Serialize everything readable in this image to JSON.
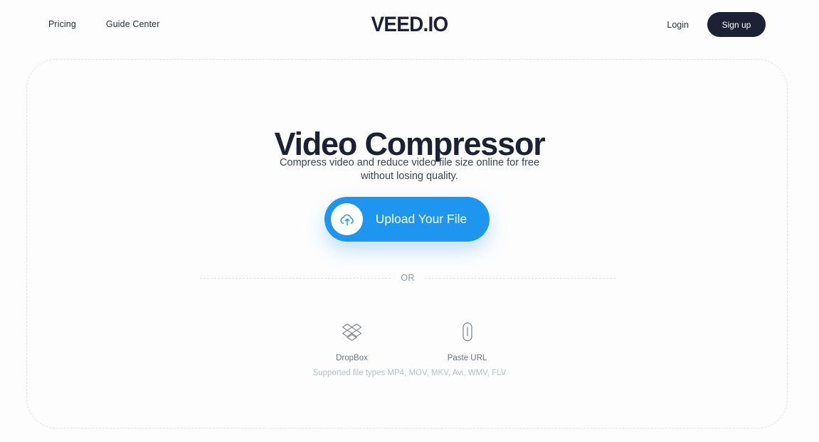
{
  "header": {
    "nav_links": [
      {
        "label": "Pricing",
        "name": "nav-link-pricing"
      },
      {
        "label": "Guide Center",
        "name": "nav-link-guide-center"
      }
    ],
    "logo": "VEED.IO",
    "login_label": "Login",
    "signup_label": "Sign up"
  },
  "hero": {
    "title": "Video Compressor",
    "subtitle": "Compress video and reduce video file size online for free without losing quality."
  },
  "upload": {
    "button_label": "Upload Your File",
    "icon": "cloud-upload-icon"
  },
  "divider": {
    "label": "OR"
  },
  "sources": [
    {
      "label": "DropBox",
      "icon": "dropbox-icon"
    },
    {
      "label": "Paste URL",
      "icon": "link-icon"
    }
  ],
  "supported_types": "Supported file types MP4, MOV, MKV, Avi, WMV, FLV",
  "colors": {
    "accent_blue": "#1e96f0",
    "dark_navy": "#1d2135",
    "page_background": "#fdfdfd",
    "dashed_border": "#e2e4ea",
    "muted_text": "#9096a4"
  }
}
